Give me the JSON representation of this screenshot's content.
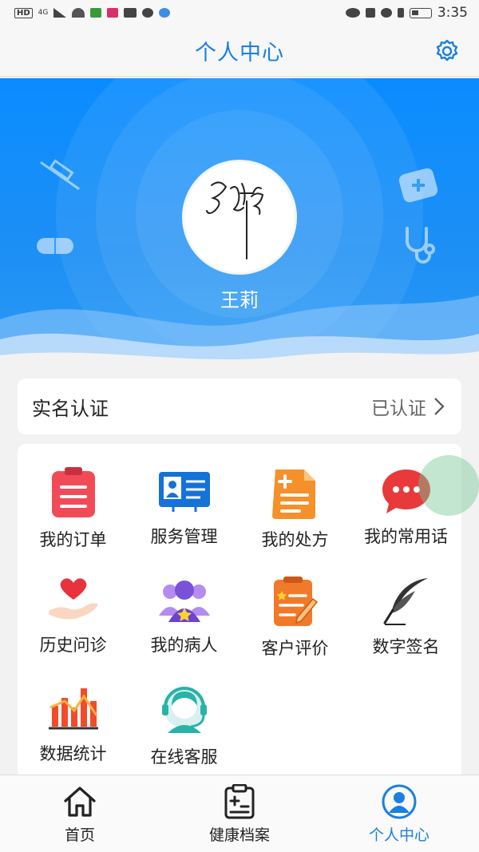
{
  "status_bar": {
    "network": "4G",
    "hd": "HD",
    "time": "3:35"
  },
  "header": {
    "title": "个人中心",
    "settings_icon": "gear-icon"
  },
  "profile": {
    "name": "王莉",
    "avatar_icon": "signature-avatar"
  },
  "verification": {
    "title": "实名认证",
    "status": "已认证"
  },
  "menu": {
    "items": [
      {
        "label": "我的订单",
        "icon": "order-clipboard-icon"
      },
      {
        "label": "服务管理",
        "icon": "id-card-icon"
      },
      {
        "label": "我的处方",
        "icon": "prescription-document-icon"
      },
      {
        "label": "我的常用话",
        "icon": "chat-bubble-icon"
      },
      {
        "label": "历史问诊",
        "icon": "heart-hand-icon"
      },
      {
        "label": "我的病人",
        "icon": "patients-group-icon"
      },
      {
        "label": "客户评价",
        "icon": "review-clipboard-icon"
      },
      {
        "label": "数字签名",
        "icon": "feather-pen-icon"
      },
      {
        "label": "数据统计",
        "icon": "bar-chart-icon"
      },
      {
        "label": "在线客服",
        "icon": "headset-service-icon"
      }
    ]
  },
  "bottom_nav": {
    "items": [
      {
        "label": "首页",
        "icon": "home-icon"
      },
      {
        "label": "健康档案",
        "icon": "health-record-icon"
      },
      {
        "label": "个人中心",
        "icon": "user-icon",
        "active": true
      }
    ]
  },
  "colors": {
    "accent": "#1a7fe0",
    "hero_blue": "#0a8cff"
  }
}
